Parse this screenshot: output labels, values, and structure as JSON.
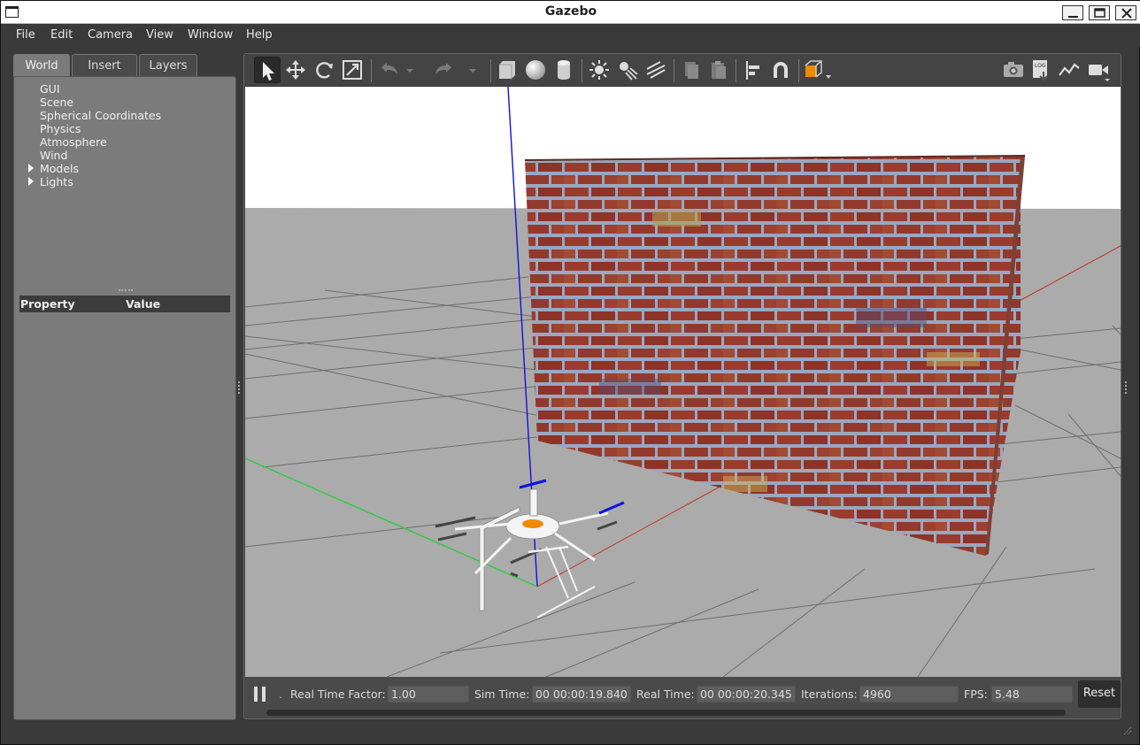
{
  "window": {
    "title": "Gazebo"
  },
  "menubar": {
    "items": [
      "File",
      "Edit",
      "Camera",
      "View",
      "Window",
      "Help"
    ]
  },
  "left_panel": {
    "tabs": [
      {
        "label": "World",
        "active": true
      },
      {
        "label": "Insert",
        "active": false
      },
      {
        "label": "Layers",
        "active": false
      }
    ],
    "tree": [
      {
        "label": "GUI",
        "expandable": false
      },
      {
        "label": "Scene",
        "expandable": false
      },
      {
        "label": "Spherical Coordinates",
        "expandable": false
      },
      {
        "label": "Physics",
        "expandable": false
      },
      {
        "label": "Atmosphere",
        "expandable": false
      },
      {
        "label": "Wind",
        "expandable": false
      },
      {
        "label": "Models",
        "expandable": true
      },
      {
        "label": "Lights",
        "expandable": true
      }
    ],
    "properties": {
      "col_property": "Property",
      "col_value": "Value"
    }
  },
  "toolbar": {
    "tools": [
      "select-mode",
      "translate-mode",
      "rotate-mode",
      "scale-mode",
      "undo",
      "undo-history",
      "redo",
      "redo-history",
      "box",
      "sphere",
      "cylinder",
      "point-light",
      "spot-light",
      "directional-light",
      "copy",
      "paste",
      "align",
      "snap",
      "view-angle"
    ],
    "right_tools": [
      "screenshot",
      "log",
      "plot",
      "video-record"
    ],
    "log_label": "LOG"
  },
  "bottom_bar": {
    "real_time_factor_label": "Real Time Factor:",
    "real_time_factor": "1.00",
    "sim_time_label": "Sim Time:",
    "sim_time": "00 00:00:19.840",
    "real_time_label": "Real Time:",
    "real_time": "00 00:00:20.345",
    "iterations_label": "Iterations:",
    "iterations": "4960",
    "fps_label": "FPS:",
    "fps": "5.48",
    "reset_label": "Reset",
    "step_marker": "."
  },
  "colors": {
    "background": "#3a3a3a",
    "viewport_ground": "#ababab",
    "sky": "#ffffff",
    "brick": "#9a3b2e",
    "mortar": "#9aa7c0",
    "axis_x": "#c0392b",
    "axis_y": "#2ecc40",
    "axis_z": "#1010e0",
    "accent_orange": "#f08a00"
  }
}
